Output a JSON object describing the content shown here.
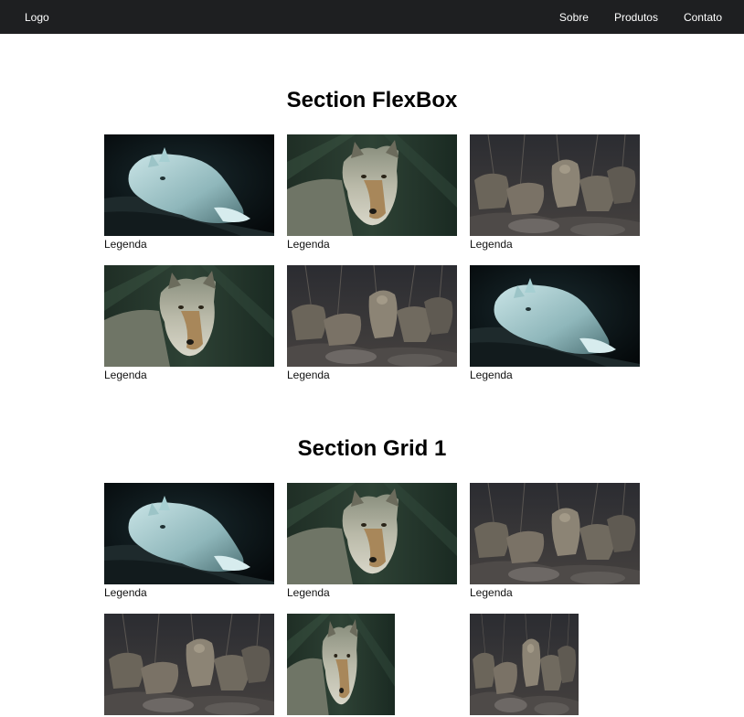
{
  "nav": {
    "logo": "Logo",
    "links": [
      "Sobre",
      "Produtos",
      "Contato"
    ]
  },
  "sections": [
    {
      "title": "Section FlexBox",
      "items": [
        {
          "image": "white-wolf-lying",
          "caption": "Legenda"
        },
        {
          "image": "gray-wolf-portrait",
          "caption": "Legenda"
        },
        {
          "image": "wolf-pack-rocks",
          "caption": "Legenda"
        },
        {
          "image": "gray-wolf-portrait",
          "caption": "Legenda"
        },
        {
          "image": "wolf-pack-rocks",
          "caption": "Legenda"
        },
        {
          "image": "white-wolf-lying",
          "caption": "Legenda"
        }
      ]
    },
    {
      "title": "Section Grid 1",
      "items": [
        {
          "image": "white-wolf-lying",
          "caption": "Legenda"
        },
        {
          "image": "gray-wolf-portrait",
          "caption": "Legenda"
        },
        {
          "image": "wolf-pack-rocks",
          "caption": "Legenda"
        },
        {
          "image": "wolf-pack-rocks",
          "caption": ""
        },
        {
          "image": "gray-wolf-portrait",
          "caption": ""
        },
        {
          "image": "wolf-pack-rocks",
          "caption": ""
        }
      ]
    }
  ]
}
